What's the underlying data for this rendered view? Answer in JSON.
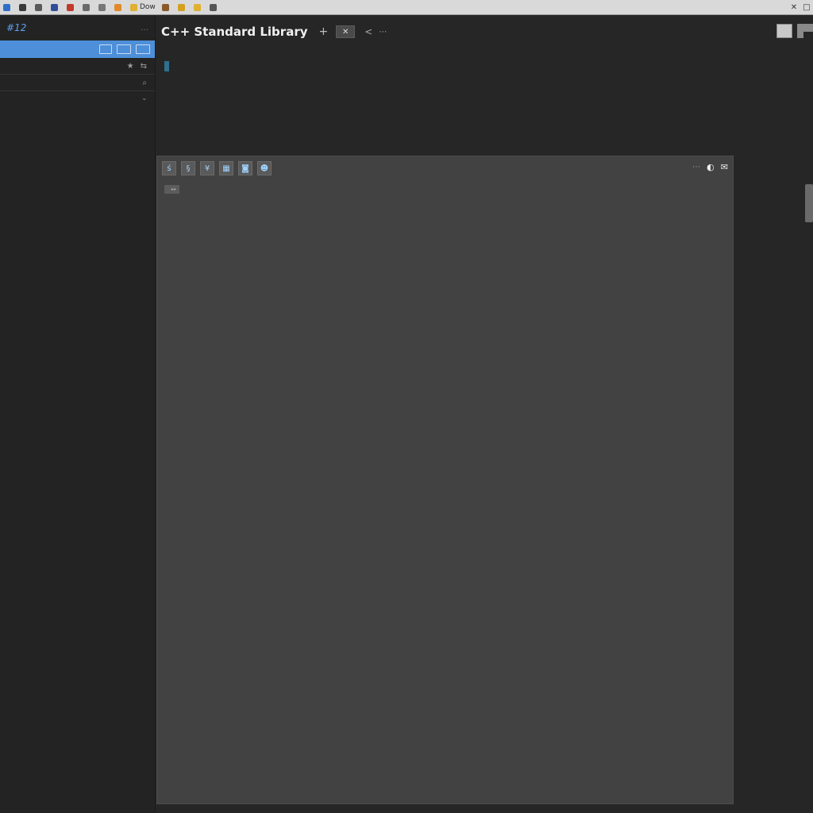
{
  "bookmarks": [
    {
      "label": "",
      "color": "#2f6fc8"
    },
    {
      "label": "",
      "color": "#3a3a3a"
    },
    {
      "label": "",
      "color": "#5a5a5a"
    },
    {
      "label": "",
      "color": "#2f4f9a"
    },
    {
      "label": "",
      "color": "#c0392b"
    },
    {
      "label": "",
      "color": "#6a6a6a"
    },
    {
      "label": "",
      "color": "#777777"
    },
    {
      "label": "",
      "color": "#e08a2a"
    },
    {
      "label": "Dow",
      "color": "#e0b030"
    },
    {
      "label": "",
      "color": "#8a5a2a"
    },
    {
      "label": "",
      "color": "#d4a020"
    },
    {
      "label": "",
      "color": "#e0b030"
    },
    {
      "label": "",
      "color": "#555555"
    }
  ],
  "sidebar": {
    "title": "#12",
    "items": [
      {
        "label": "",
        "icon": "star-icon",
        "icon_glyph": "★",
        "icon2_glyph": "⇆"
      },
      {
        "label": "",
        "icon": "search-icon",
        "icon_glyph": "⌕",
        "icon2_glyph": ""
      }
    ]
  },
  "header": {
    "title": "C++ Standard Library",
    "plus_glyph": "+",
    "close_glyph": "✕",
    "back_glyph": "<"
  },
  "code": {
    "line1_badge": "",
    "line1_ext": ""
  },
  "panel": {
    "toolbar_glyphs": [
      "ś",
      "§",
      "¥",
      "▦",
      "◙",
      "☻"
    ],
    "tag_close": "↔"
  },
  "colors": {
    "accent": "#4d8fd9",
    "background": "#262626",
    "panel": "#424242",
    "keyword_green": "#7bc25c",
    "highlight_yellow": "#f2d34a"
  }
}
